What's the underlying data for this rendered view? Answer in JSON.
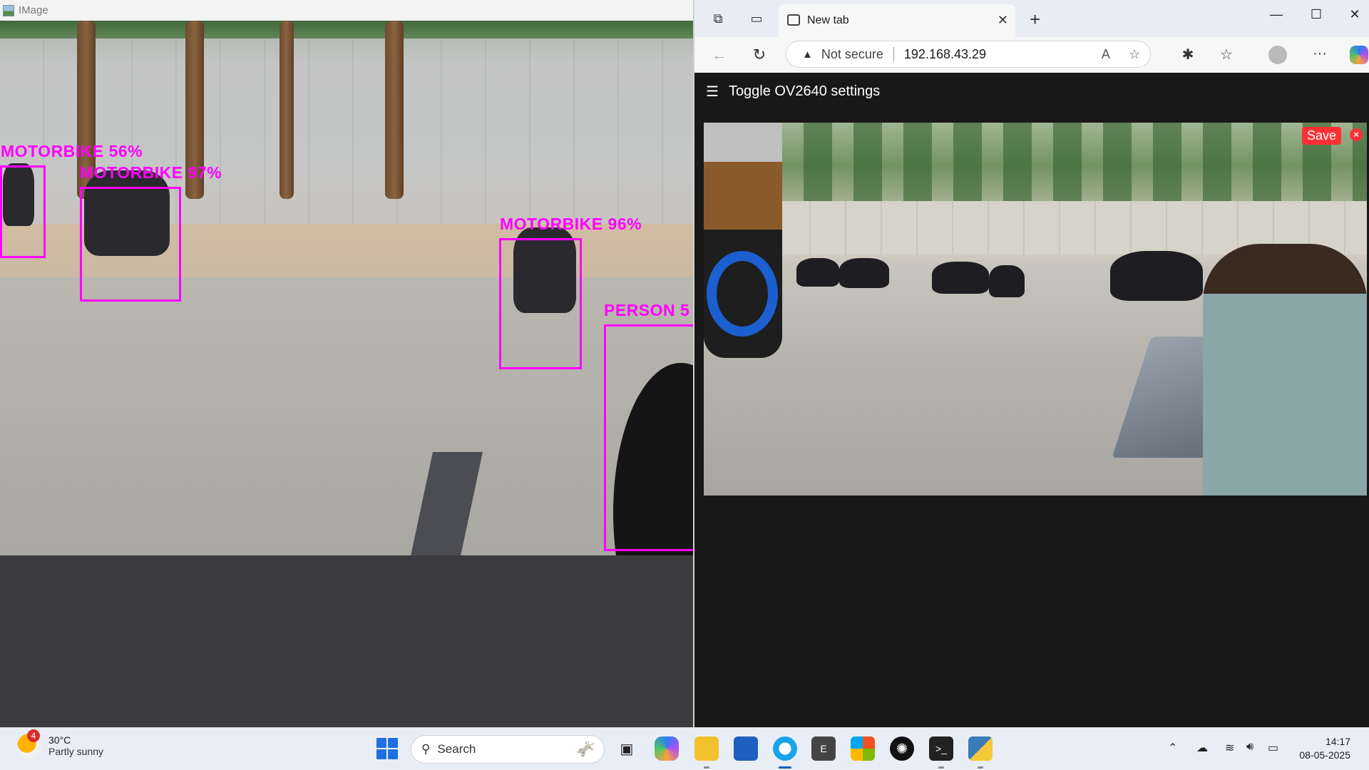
{
  "image_window": {
    "title": "IMage",
    "detections": [
      {
        "label": "MOTORBIKE 56%"
      },
      {
        "label": "MOTORBIKE 97%"
      },
      {
        "label": "MOTORBIKE 96%"
      },
      {
        "label": "PERSON 5"
      }
    ]
  },
  "browser": {
    "tab_title": "New tab",
    "security_label": "Not secure",
    "address": "192.168.43.29",
    "page": {
      "settings_toggle": "Toggle OV2640 settings",
      "save_label": "Save",
      "close_label": "×"
    }
  },
  "taskbar": {
    "weather_badge": "4",
    "weather_temp": "30°C",
    "weather_condition": "Partly sunny",
    "search_label": "Search",
    "clock_time": "14:17",
    "clock_date": "08-05-2025"
  }
}
